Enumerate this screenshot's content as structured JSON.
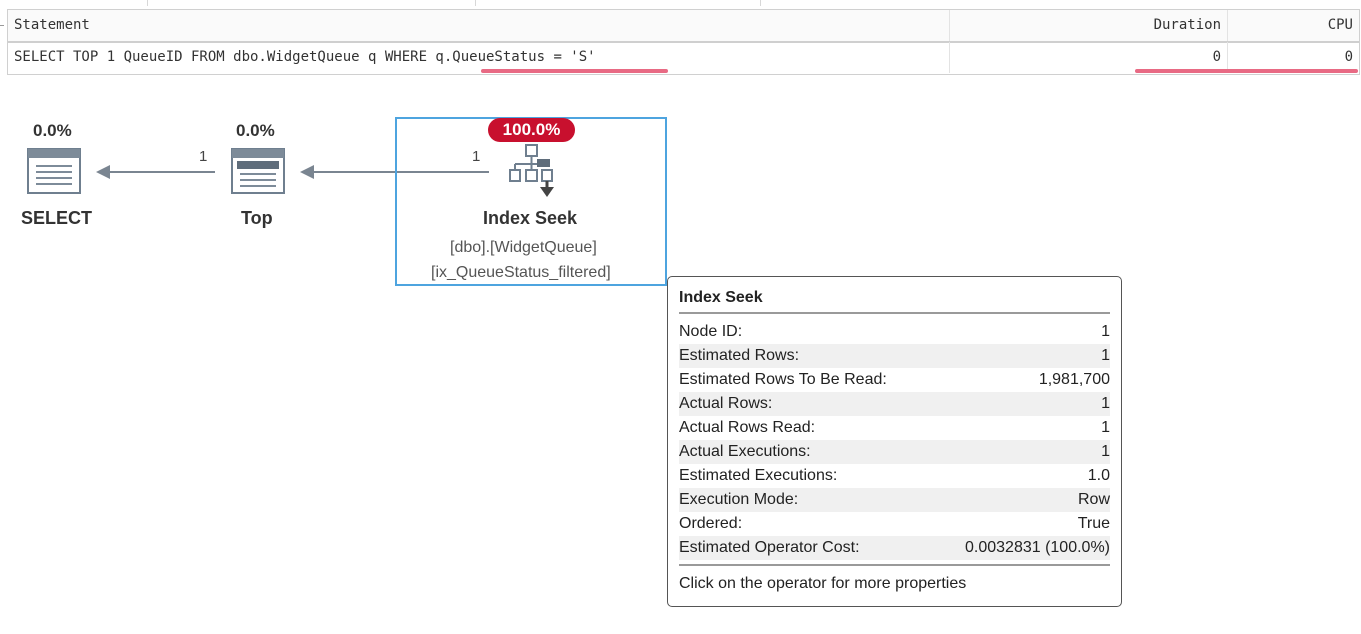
{
  "grid": {
    "headers": {
      "statement": "Statement",
      "duration": "Duration",
      "cpu": "CPU"
    },
    "row": {
      "statement": "SELECT TOP 1 QueueID FROM dbo.WidgetQueue q WHERE q.QueueStatus = 'S'",
      "duration": "0",
      "cpu": "0"
    },
    "highlight_color": "#e86a84"
  },
  "plan": {
    "select": {
      "cost": "0.0%",
      "label": "SELECT",
      "icon": "result-table-icon"
    },
    "top": {
      "cost": "0.0%",
      "label": "Top",
      "icon": "top-operator-icon",
      "rows_out": "1"
    },
    "seek": {
      "cost": "100.0%",
      "label": "Index Seek",
      "table": "[dbo].[WidgetQueue]",
      "index": "[ix_QueueStatus_filtered]",
      "icon": "index-seek-icon",
      "rows_out": "1",
      "badge_color": "#c8102e",
      "selected_border_color": "#4ea4df"
    }
  },
  "tooltip": {
    "title": "Index Seek",
    "properties": [
      {
        "key": "Node ID:",
        "value": "1"
      },
      {
        "key": "Estimated Rows:",
        "value": "1"
      },
      {
        "key": "Estimated Rows To Be Read:",
        "value": "1,981,700"
      },
      {
        "key": "Actual Rows:",
        "value": "1"
      },
      {
        "key": "Actual Rows Read:",
        "value": "1"
      },
      {
        "key": "Actual Executions:",
        "value": "1"
      },
      {
        "key": "Estimated Executions:",
        "value": "1.0"
      },
      {
        "key": "Execution Mode:",
        "value": "Row"
      },
      {
        "key": "Ordered:",
        "value": "True"
      },
      {
        "key": "Estimated Operator Cost:",
        "value": "0.0032831 (100.0%)"
      }
    ],
    "footer": "Click on the operator for more properties"
  }
}
